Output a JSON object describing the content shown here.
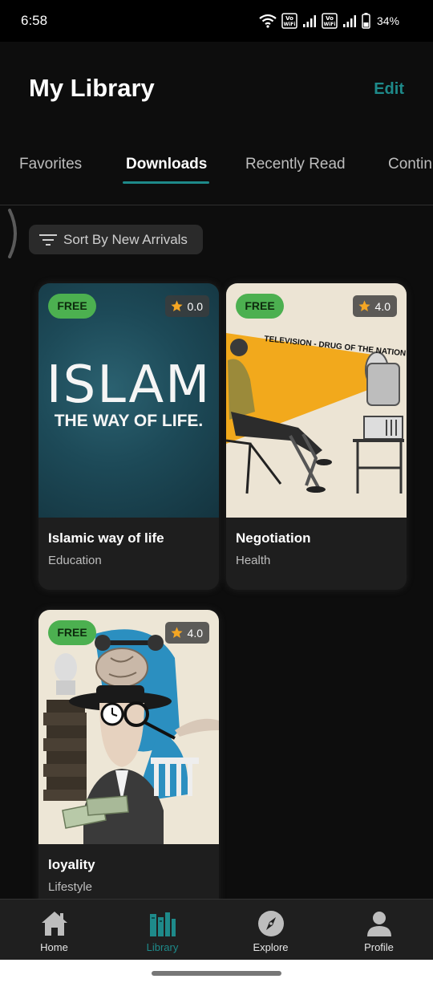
{
  "status_bar": {
    "time": "6:58",
    "battery": "34%",
    "icons": [
      "wifi-icon",
      "volte-icon",
      "signal-icon",
      "volte-icon",
      "signal-icon",
      "battery-icon"
    ]
  },
  "header": {
    "title": "My Library",
    "edit_label": "Edit",
    "accent_color": "#1e8a8a"
  },
  "tabs": [
    {
      "label": "Favorites",
      "active": false
    },
    {
      "label": "Downloads",
      "active": true
    },
    {
      "label": "Recently Read",
      "active": false
    },
    {
      "label": "Contin",
      "active": false
    }
  ],
  "sort": {
    "label": "Sort By New Arrivals",
    "icon": "sort-icon"
  },
  "books": [
    {
      "title": "Islamic way of life",
      "category": "Education",
      "badge": "FREE",
      "rating": "0.0",
      "cover_text_main": "ISLAM",
      "cover_text_sub": "THE WAY OF LIFE."
    },
    {
      "title": "Negotiation",
      "category": "Health",
      "badge": "FREE",
      "rating": "4.0",
      "cover_text_main": "TELEVISION - DRUG OF THE NATION"
    },
    {
      "title": "loyality",
      "category": "Lifestyle",
      "badge": "FREE",
      "rating": "4.0"
    }
  ],
  "bottom_nav": [
    {
      "label": "Home",
      "icon": "home-icon",
      "active": false
    },
    {
      "label": "Library",
      "icon": "library-icon",
      "active": true
    },
    {
      "label": "Explore",
      "icon": "compass-icon",
      "active": false
    },
    {
      "label": "Profile",
      "icon": "profile-icon",
      "active": false
    }
  ],
  "colors": {
    "background": "#0d0d0d",
    "card": "#1e1e1e",
    "free_badge": "#4cb050",
    "star": "#f5a623"
  }
}
